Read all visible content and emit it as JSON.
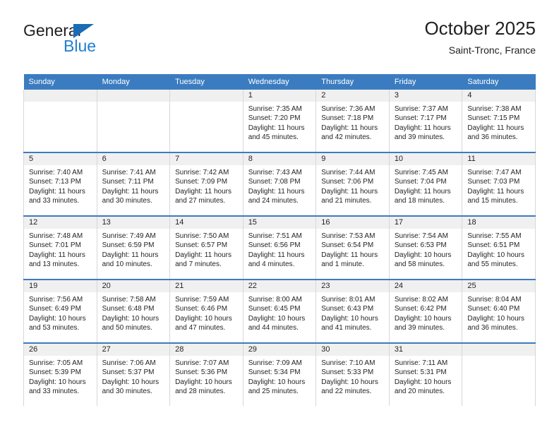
{
  "brand": {
    "name_top": "General",
    "name_bottom": "Blue",
    "accent_color": "#1a6cb5"
  },
  "header": {
    "title": "October 2025",
    "location": "Saint-Tronc, France",
    "header_bg": "#3b7cc0",
    "header_text_color": "#ffffff"
  },
  "weekdays": [
    "Sunday",
    "Monday",
    "Tuesday",
    "Wednesday",
    "Thursday",
    "Friday",
    "Saturday"
  ],
  "weeks": [
    [
      {
        "day": "",
        "sunrise": "",
        "sunset": "",
        "daylight_line1": "",
        "daylight_line2": ""
      },
      {
        "day": "",
        "sunrise": "",
        "sunset": "",
        "daylight_line1": "",
        "daylight_line2": ""
      },
      {
        "day": "",
        "sunrise": "",
        "sunset": "",
        "daylight_line1": "",
        "daylight_line2": ""
      },
      {
        "day": "1",
        "sunrise": "Sunrise: 7:35 AM",
        "sunset": "Sunset: 7:20 PM",
        "daylight_line1": "Daylight: 11 hours",
        "daylight_line2": "and 45 minutes."
      },
      {
        "day": "2",
        "sunrise": "Sunrise: 7:36 AM",
        "sunset": "Sunset: 7:18 PM",
        "daylight_line1": "Daylight: 11 hours",
        "daylight_line2": "and 42 minutes."
      },
      {
        "day": "3",
        "sunrise": "Sunrise: 7:37 AM",
        "sunset": "Sunset: 7:17 PM",
        "daylight_line1": "Daylight: 11 hours",
        "daylight_line2": "and 39 minutes."
      },
      {
        "day": "4",
        "sunrise": "Sunrise: 7:38 AM",
        "sunset": "Sunset: 7:15 PM",
        "daylight_line1": "Daylight: 11 hours",
        "daylight_line2": "and 36 minutes."
      }
    ],
    [
      {
        "day": "5",
        "sunrise": "Sunrise: 7:40 AM",
        "sunset": "Sunset: 7:13 PM",
        "daylight_line1": "Daylight: 11 hours",
        "daylight_line2": "and 33 minutes."
      },
      {
        "day": "6",
        "sunrise": "Sunrise: 7:41 AM",
        "sunset": "Sunset: 7:11 PM",
        "daylight_line1": "Daylight: 11 hours",
        "daylight_line2": "and 30 minutes."
      },
      {
        "day": "7",
        "sunrise": "Sunrise: 7:42 AM",
        "sunset": "Sunset: 7:09 PM",
        "daylight_line1": "Daylight: 11 hours",
        "daylight_line2": "and 27 minutes."
      },
      {
        "day": "8",
        "sunrise": "Sunrise: 7:43 AM",
        "sunset": "Sunset: 7:08 PM",
        "daylight_line1": "Daylight: 11 hours",
        "daylight_line2": "and 24 minutes."
      },
      {
        "day": "9",
        "sunrise": "Sunrise: 7:44 AM",
        "sunset": "Sunset: 7:06 PM",
        "daylight_line1": "Daylight: 11 hours",
        "daylight_line2": "and 21 minutes."
      },
      {
        "day": "10",
        "sunrise": "Sunrise: 7:45 AM",
        "sunset": "Sunset: 7:04 PM",
        "daylight_line1": "Daylight: 11 hours",
        "daylight_line2": "and 18 minutes."
      },
      {
        "day": "11",
        "sunrise": "Sunrise: 7:47 AM",
        "sunset": "Sunset: 7:03 PM",
        "daylight_line1": "Daylight: 11 hours",
        "daylight_line2": "and 15 minutes."
      }
    ],
    [
      {
        "day": "12",
        "sunrise": "Sunrise: 7:48 AM",
        "sunset": "Sunset: 7:01 PM",
        "daylight_line1": "Daylight: 11 hours",
        "daylight_line2": "and 13 minutes."
      },
      {
        "day": "13",
        "sunrise": "Sunrise: 7:49 AM",
        "sunset": "Sunset: 6:59 PM",
        "daylight_line1": "Daylight: 11 hours",
        "daylight_line2": "and 10 minutes."
      },
      {
        "day": "14",
        "sunrise": "Sunrise: 7:50 AM",
        "sunset": "Sunset: 6:57 PM",
        "daylight_line1": "Daylight: 11 hours",
        "daylight_line2": "and 7 minutes."
      },
      {
        "day": "15",
        "sunrise": "Sunrise: 7:51 AM",
        "sunset": "Sunset: 6:56 PM",
        "daylight_line1": "Daylight: 11 hours",
        "daylight_line2": "and 4 minutes."
      },
      {
        "day": "16",
        "sunrise": "Sunrise: 7:53 AM",
        "sunset": "Sunset: 6:54 PM",
        "daylight_line1": "Daylight: 11 hours",
        "daylight_line2": "and 1 minute."
      },
      {
        "day": "17",
        "sunrise": "Sunrise: 7:54 AM",
        "sunset": "Sunset: 6:53 PM",
        "daylight_line1": "Daylight: 10 hours",
        "daylight_line2": "and 58 minutes."
      },
      {
        "day": "18",
        "sunrise": "Sunrise: 7:55 AM",
        "sunset": "Sunset: 6:51 PM",
        "daylight_line1": "Daylight: 10 hours",
        "daylight_line2": "and 55 minutes."
      }
    ],
    [
      {
        "day": "19",
        "sunrise": "Sunrise: 7:56 AM",
        "sunset": "Sunset: 6:49 PM",
        "daylight_line1": "Daylight: 10 hours",
        "daylight_line2": "and 53 minutes."
      },
      {
        "day": "20",
        "sunrise": "Sunrise: 7:58 AM",
        "sunset": "Sunset: 6:48 PM",
        "daylight_line1": "Daylight: 10 hours",
        "daylight_line2": "and 50 minutes."
      },
      {
        "day": "21",
        "sunrise": "Sunrise: 7:59 AM",
        "sunset": "Sunset: 6:46 PM",
        "daylight_line1": "Daylight: 10 hours",
        "daylight_line2": "and 47 minutes."
      },
      {
        "day": "22",
        "sunrise": "Sunrise: 8:00 AM",
        "sunset": "Sunset: 6:45 PM",
        "daylight_line1": "Daylight: 10 hours",
        "daylight_line2": "and 44 minutes."
      },
      {
        "day": "23",
        "sunrise": "Sunrise: 8:01 AM",
        "sunset": "Sunset: 6:43 PM",
        "daylight_line1": "Daylight: 10 hours",
        "daylight_line2": "and 41 minutes."
      },
      {
        "day": "24",
        "sunrise": "Sunrise: 8:02 AM",
        "sunset": "Sunset: 6:42 PM",
        "daylight_line1": "Daylight: 10 hours",
        "daylight_line2": "and 39 minutes."
      },
      {
        "day": "25",
        "sunrise": "Sunrise: 8:04 AM",
        "sunset": "Sunset: 6:40 PM",
        "daylight_line1": "Daylight: 10 hours",
        "daylight_line2": "and 36 minutes."
      }
    ],
    [
      {
        "day": "26",
        "sunrise": "Sunrise: 7:05 AM",
        "sunset": "Sunset: 5:39 PM",
        "daylight_line1": "Daylight: 10 hours",
        "daylight_line2": "and 33 minutes."
      },
      {
        "day": "27",
        "sunrise": "Sunrise: 7:06 AM",
        "sunset": "Sunset: 5:37 PM",
        "daylight_line1": "Daylight: 10 hours",
        "daylight_line2": "and 30 minutes."
      },
      {
        "day": "28",
        "sunrise": "Sunrise: 7:07 AM",
        "sunset": "Sunset: 5:36 PM",
        "daylight_line1": "Daylight: 10 hours",
        "daylight_line2": "and 28 minutes."
      },
      {
        "day": "29",
        "sunrise": "Sunrise: 7:09 AM",
        "sunset": "Sunset: 5:34 PM",
        "daylight_line1": "Daylight: 10 hours",
        "daylight_line2": "and 25 minutes."
      },
      {
        "day": "30",
        "sunrise": "Sunrise: 7:10 AM",
        "sunset": "Sunset: 5:33 PM",
        "daylight_line1": "Daylight: 10 hours",
        "daylight_line2": "and 22 minutes."
      },
      {
        "day": "31",
        "sunrise": "Sunrise: 7:11 AM",
        "sunset": "Sunset: 5:31 PM",
        "daylight_line1": "Daylight: 10 hours",
        "daylight_line2": "and 20 minutes."
      },
      {
        "day": "",
        "sunrise": "",
        "sunset": "",
        "daylight_line1": "",
        "daylight_line2": ""
      }
    ]
  ]
}
